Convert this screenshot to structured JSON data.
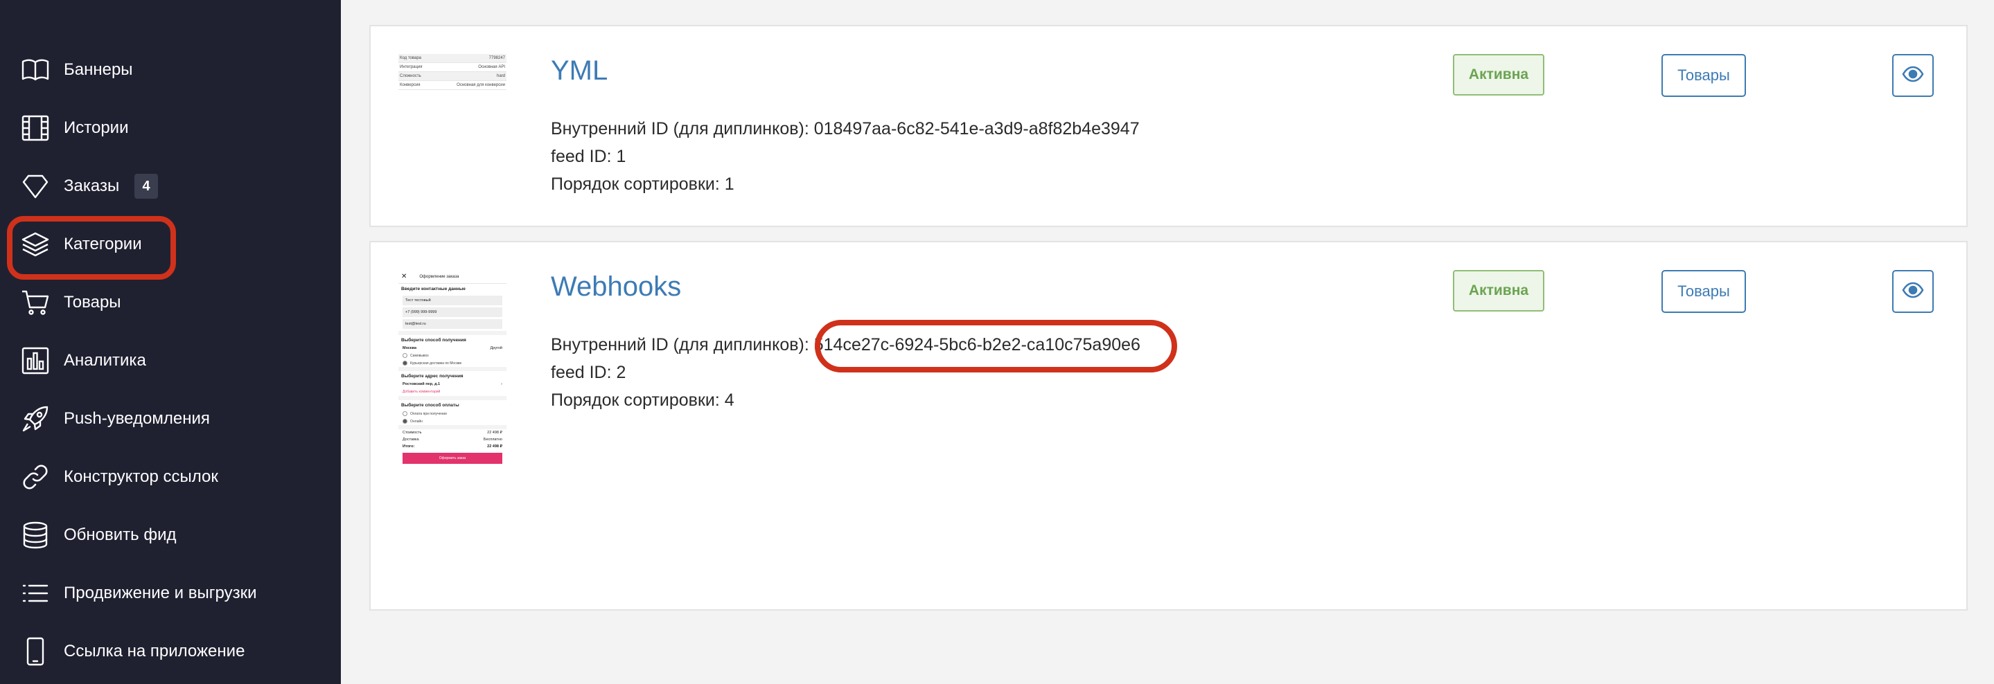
{
  "sidebar": {
    "items": [
      {
        "label": "Баннеры",
        "icon": "book-icon"
      },
      {
        "label": "Истории",
        "icon": "film-icon"
      },
      {
        "label": "Заказы",
        "icon": "diamond-icon",
        "badge": "4"
      },
      {
        "label": "Категории",
        "icon": "layers-icon",
        "highlighted": true
      },
      {
        "label": "Товары",
        "icon": "cart-icon"
      },
      {
        "label": "Аналитика",
        "icon": "bar-chart-icon"
      },
      {
        "label": "Push-уведомления",
        "icon": "rocket-icon"
      },
      {
        "label": "Конструктор ссылок",
        "icon": "link-icon"
      },
      {
        "label": "Обновить фид",
        "icon": "database-icon"
      },
      {
        "label": "Продвижение и выгрузки",
        "icon": "list-icon"
      },
      {
        "label": "Ссылка на приложение",
        "icon": "phone-icon"
      }
    ]
  },
  "feeds": [
    {
      "title": "YML",
      "internal_id_label": "Внутренний ID (для диплинков): ",
      "internal_id": "018497aa-6c82-541e-a3d9-a8f82b4e3947",
      "feed_id_line": "feed ID: 1",
      "sort_line": "Порядок сортировки: 1",
      "status": "Активна",
      "goods_button": "Товары",
      "view_icon": "eye-icon",
      "thumb": {
        "rows": [
          {
            "k": "Код товара",
            "v": "7798247"
          },
          {
            "k": "Интеграция",
            "v": "Основная API"
          },
          {
            "k": "Сложность",
            "v": "hard"
          },
          {
            "k": "Конверсия",
            "v": "Основная для конверсии"
          }
        ]
      }
    },
    {
      "title": "Webhooks",
      "internal_id_label": "Внутренний ID (для диплинков): ",
      "internal_id": "514ce27c-6924-5bc6-b2e2-ca10c75a90e6",
      "feed_id_line": "feed ID: 2",
      "sort_line": "Порядок сортировки: 4",
      "status": "Активна",
      "goods_button": "Товары",
      "view_icon": "eye-icon",
      "id_highlighted": true,
      "thumb": {
        "header": "Оформление заказа",
        "contact_title": "Введите контактные данные",
        "name": "Тест тестовый",
        "phone": "+7 (999) 999-9999",
        "email": "test@test.ru",
        "delivery_title": "Выберите способ получения",
        "city_label": "Москва",
        "city_value": "Другой",
        "pickup": "Самовывоз",
        "courier": "Курьерская доставка по Москве",
        "address_title": "Выберите адрес получения",
        "address": "Ростовский пер, д.1",
        "comment": "Добавить комментарий",
        "payment_title": "Выберите способ оплаты",
        "pay_on_receipt": "Оплата при получении",
        "pay_online": "Онлайн",
        "cost_label": "Стоимость",
        "cost_value": "22 498 ₽",
        "delivery_label": "Доставка",
        "delivery_value": "Бесплатно",
        "total_label": "Итого:",
        "total_value": "22 498 ₽",
        "submit": "Оформить заказ"
      }
    }
  ],
  "colors": {
    "sidebar_bg": "#1f2131",
    "accent": "#3d7bb4",
    "status_green": "#6aa451",
    "highlight_red": "#d0311b"
  }
}
